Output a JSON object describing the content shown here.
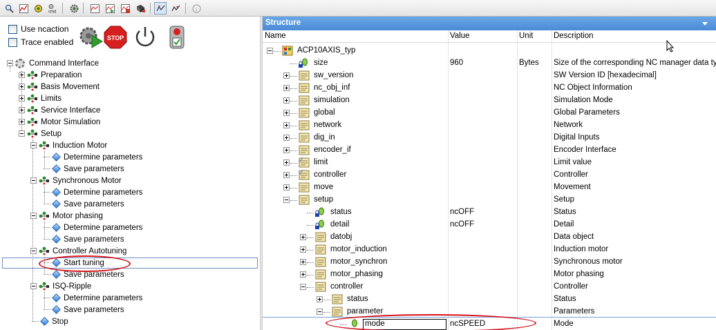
{
  "toolbar": {
    "buttons": [
      {
        "name": "search-settings-icon",
        "color": "#4a6fae"
      },
      {
        "name": "trace-chart-icon",
        "color": "#c0392b"
      },
      {
        "name": "modules-icon",
        "color": "#2f7f2f"
      },
      {
        "name": "cmd-icon",
        "label": "cmd"
      },
      {
        "name": "settings-gear-icon",
        "color": "#3c7a3c"
      },
      {
        "name": "chart-view-icon",
        "color": "#d9534f"
      },
      {
        "name": "chart-play-icon",
        "color": "#3a9d3a"
      },
      {
        "name": "chart-stop-icon",
        "color": "#c0392b"
      },
      {
        "name": "download-icon",
        "color": "#444444"
      },
      {
        "name": "cursor-watch-icon",
        "color": "#c0392b"
      },
      {
        "name": "cursor-record-icon",
        "color": "#c0392b"
      },
      {
        "name": "info-icon",
        "label": "i"
      }
    ]
  },
  "left": {
    "use_ncaction": "Use ncaction",
    "trace_enabled": "Trace enabled",
    "big_icons": [
      "start-icon",
      "stop-icon",
      "power-icon",
      "traffic-light-icon"
    ],
    "stop_label": "STOP",
    "tree": {
      "root": "Command Interface",
      "items": [
        {
          "label": "Preparation"
        },
        {
          "label": "Basis Movement"
        },
        {
          "label": "Limits"
        },
        {
          "label": "Service Interface"
        },
        {
          "label": "Motor Simulation"
        },
        {
          "label": "Setup"
        },
        {
          "label": "Induction Motor"
        },
        {
          "label": "Determine parameters"
        },
        {
          "label": "Save parameters"
        },
        {
          "label": "Synchronous Motor"
        },
        {
          "label": "Determine parameters"
        },
        {
          "label": "Save parameters"
        },
        {
          "label": "Motor phasing"
        },
        {
          "label": "Determine parameters"
        },
        {
          "label": "Save parameters"
        },
        {
          "label": "Controller Autotuning"
        },
        {
          "label": "Start tuning"
        },
        {
          "label": "Save parameters"
        },
        {
          "label": "ISQ-Ripple"
        },
        {
          "label": "Determine parameters"
        },
        {
          "label": "Save parameters"
        },
        {
          "label": "Stop"
        }
      ]
    }
  },
  "right": {
    "title": "Structure",
    "columns": {
      "name": "Name",
      "value": "Value",
      "unit": "Unit",
      "description": "Description"
    },
    "rows": [
      {
        "name": "ACP10AXIS_typ",
        "value": "",
        "unit": "",
        "description": ""
      },
      {
        "name": "size",
        "value": "960",
        "unit": "Bytes",
        "description": "Size of the corresponding NC manager data type"
      },
      {
        "name": "sw_version",
        "value": "",
        "unit": "",
        "description": "SW Version ID [hexadecimal]"
      },
      {
        "name": "nc_obj_inf",
        "value": "",
        "unit": "",
        "description": "NC Object Information"
      },
      {
        "name": "simulation",
        "value": "",
        "unit": "",
        "description": "Simulation Mode"
      },
      {
        "name": "global",
        "value": "",
        "unit": "",
        "description": "Global Parameters"
      },
      {
        "name": "network",
        "value": "",
        "unit": "",
        "description": "Network"
      },
      {
        "name": "dig_in",
        "value": "",
        "unit": "",
        "description": "Digital Inputs"
      },
      {
        "name": "encoder_if",
        "value": "",
        "unit": "",
        "description": "Encoder Interface"
      },
      {
        "name": "limit",
        "value": "",
        "unit": "",
        "description": "Limit value"
      },
      {
        "name": "controller",
        "value": "",
        "unit": "",
        "description": "Controller"
      },
      {
        "name": "move",
        "value": "",
        "unit": "",
        "description": "Movement"
      },
      {
        "name": "setup",
        "value": "",
        "unit": "",
        "description": "Setup"
      },
      {
        "name": "status",
        "value": "ncOFF",
        "unit": "",
        "description": "Status"
      },
      {
        "name": "detail",
        "value": "ncOFF",
        "unit": "",
        "description": "Detail"
      },
      {
        "name": "datobj",
        "value": "",
        "unit": "",
        "description": "Data object"
      },
      {
        "name": "motor_induction",
        "value": "",
        "unit": "",
        "description": "Induction motor"
      },
      {
        "name": "motor_synchron",
        "value": "",
        "unit": "",
        "description": "Synchronous motor"
      },
      {
        "name": "motor_phasing",
        "value": "",
        "unit": "",
        "description": "Motor phasing"
      },
      {
        "name": "controller",
        "value": "",
        "unit": "",
        "description": "Controller"
      },
      {
        "name": "status",
        "value": "",
        "unit": "",
        "description": "Status"
      },
      {
        "name": "parameter",
        "value": "",
        "unit": "",
        "description": "Parameters"
      },
      {
        "name": "mode",
        "value": "ncSPEED",
        "unit": "",
        "description": "Mode"
      }
    ]
  },
  "colors": {
    "title_bar": "#4a8ad6",
    "highlight_red": "#d6101b"
  }
}
